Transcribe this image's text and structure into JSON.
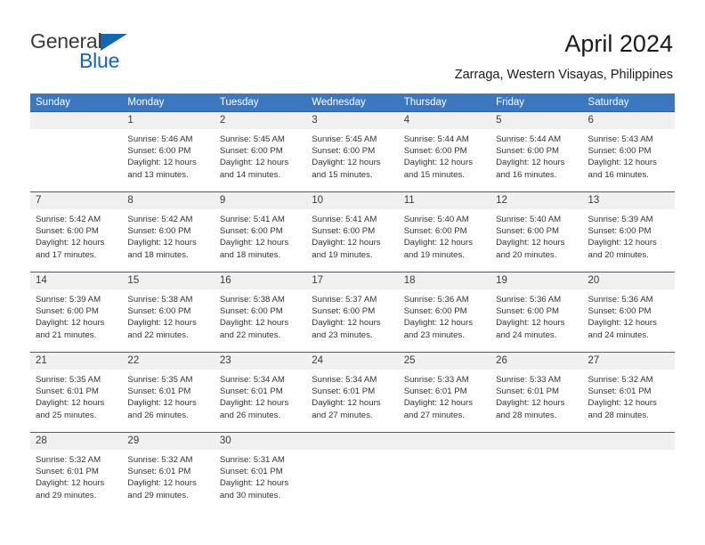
{
  "brand": {
    "name_part1": "General",
    "name_part2": "Blue"
  },
  "header": {
    "title": "April 2024",
    "location": "Zarraga, Western Visayas, Philippines"
  },
  "colors": {
    "header_blue": "#3b78bf",
    "separator_blue": "#2a62a8",
    "day_band_gray": "#f0f0f0",
    "brand_blue": "#1466b3"
  },
  "calendar": {
    "day_headers": [
      "Sunday",
      "Monday",
      "Tuesday",
      "Wednesday",
      "Thursday",
      "Friday",
      "Saturday"
    ],
    "weeks": [
      {
        "days": [
          {
            "num": "",
            "sunrise": "",
            "sunset": "",
            "daylight1": "",
            "daylight2": ""
          },
          {
            "num": "1",
            "sunrise": "Sunrise: 5:46 AM",
            "sunset": "Sunset: 6:00 PM",
            "daylight1": "Daylight: 12 hours",
            "daylight2": "and 13 minutes."
          },
          {
            "num": "2",
            "sunrise": "Sunrise: 5:45 AM",
            "sunset": "Sunset: 6:00 PM",
            "daylight1": "Daylight: 12 hours",
            "daylight2": "and 14 minutes."
          },
          {
            "num": "3",
            "sunrise": "Sunrise: 5:45 AM",
            "sunset": "Sunset: 6:00 PM",
            "daylight1": "Daylight: 12 hours",
            "daylight2": "and 15 minutes."
          },
          {
            "num": "4",
            "sunrise": "Sunrise: 5:44 AM",
            "sunset": "Sunset: 6:00 PM",
            "daylight1": "Daylight: 12 hours",
            "daylight2": "and 15 minutes."
          },
          {
            "num": "5",
            "sunrise": "Sunrise: 5:44 AM",
            "sunset": "Sunset: 6:00 PM",
            "daylight1": "Daylight: 12 hours",
            "daylight2": "and 16 minutes."
          },
          {
            "num": "6",
            "sunrise": "Sunrise: 5:43 AM",
            "sunset": "Sunset: 6:00 PM",
            "daylight1": "Daylight: 12 hours",
            "daylight2": "and 16 minutes."
          }
        ]
      },
      {
        "days": [
          {
            "num": "7",
            "sunrise": "Sunrise: 5:42 AM",
            "sunset": "Sunset: 6:00 PM",
            "daylight1": "Daylight: 12 hours",
            "daylight2": "and 17 minutes."
          },
          {
            "num": "8",
            "sunrise": "Sunrise: 5:42 AM",
            "sunset": "Sunset: 6:00 PM",
            "daylight1": "Daylight: 12 hours",
            "daylight2": "and 18 minutes."
          },
          {
            "num": "9",
            "sunrise": "Sunrise: 5:41 AM",
            "sunset": "Sunset: 6:00 PM",
            "daylight1": "Daylight: 12 hours",
            "daylight2": "and 18 minutes."
          },
          {
            "num": "10",
            "sunrise": "Sunrise: 5:41 AM",
            "sunset": "Sunset: 6:00 PM",
            "daylight1": "Daylight: 12 hours",
            "daylight2": "and 19 minutes."
          },
          {
            "num": "11",
            "sunrise": "Sunrise: 5:40 AM",
            "sunset": "Sunset: 6:00 PM",
            "daylight1": "Daylight: 12 hours",
            "daylight2": "and 19 minutes."
          },
          {
            "num": "12",
            "sunrise": "Sunrise: 5:40 AM",
            "sunset": "Sunset: 6:00 PM",
            "daylight1": "Daylight: 12 hours",
            "daylight2": "and 20 minutes."
          },
          {
            "num": "13",
            "sunrise": "Sunrise: 5:39 AM",
            "sunset": "Sunset: 6:00 PM",
            "daylight1": "Daylight: 12 hours",
            "daylight2": "and 20 minutes."
          }
        ]
      },
      {
        "days": [
          {
            "num": "14",
            "sunrise": "Sunrise: 5:39 AM",
            "sunset": "Sunset: 6:00 PM",
            "daylight1": "Daylight: 12 hours",
            "daylight2": "and 21 minutes."
          },
          {
            "num": "15",
            "sunrise": "Sunrise: 5:38 AM",
            "sunset": "Sunset: 6:00 PM",
            "daylight1": "Daylight: 12 hours",
            "daylight2": "and 22 minutes."
          },
          {
            "num": "16",
            "sunrise": "Sunrise: 5:38 AM",
            "sunset": "Sunset: 6:00 PM",
            "daylight1": "Daylight: 12 hours",
            "daylight2": "and 22 minutes."
          },
          {
            "num": "17",
            "sunrise": "Sunrise: 5:37 AM",
            "sunset": "Sunset: 6:00 PM",
            "daylight1": "Daylight: 12 hours",
            "daylight2": "and 23 minutes."
          },
          {
            "num": "18",
            "sunrise": "Sunrise: 5:36 AM",
            "sunset": "Sunset: 6:00 PM",
            "daylight1": "Daylight: 12 hours",
            "daylight2": "and 23 minutes."
          },
          {
            "num": "19",
            "sunrise": "Sunrise: 5:36 AM",
            "sunset": "Sunset: 6:00 PM",
            "daylight1": "Daylight: 12 hours",
            "daylight2": "and 24 minutes."
          },
          {
            "num": "20",
            "sunrise": "Sunrise: 5:36 AM",
            "sunset": "Sunset: 6:00 PM",
            "daylight1": "Daylight: 12 hours",
            "daylight2": "and 24 minutes."
          }
        ]
      },
      {
        "days": [
          {
            "num": "21",
            "sunrise": "Sunrise: 5:35 AM",
            "sunset": "Sunset: 6:01 PM",
            "daylight1": "Daylight: 12 hours",
            "daylight2": "and 25 minutes."
          },
          {
            "num": "22",
            "sunrise": "Sunrise: 5:35 AM",
            "sunset": "Sunset: 6:01 PM",
            "daylight1": "Daylight: 12 hours",
            "daylight2": "and 26 minutes."
          },
          {
            "num": "23",
            "sunrise": "Sunrise: 5:34 AM",
            "sunset": "Sunset: 6:01 PM",
            "daylight1": "Daylight: 12 hours",
            "daylight2": "and 26 minutes."
          },
          {
            "num": "24",
            "sunrise": "Sunrise: 5:34 AM",
            "sunset": "Sunset: 6:01 PM",
            "daylight1": "Daylight: 12 hours",
            "daylight2": "and 27 minutes."
          },
          {
            "num": "25",
            "sunrise": "Sunrise: 5:33 AM",
            "sunset": "Sunset: 6:01 PM",
            "daylight1": "Daylight: 12 hours",
            "daylight2": "and 27 minutes."
          },
          {
            "num": "26",
            "sunrise": "Sunrise: 5:33 AM",
            "sunset": "Sunset: 6:01 PM",
            "daylight1": "Daylight: 12 hours",
            "daylight2": "and 28 minutes."
          },
          {
            "num": "27",
            "sunrise": "Sunrise: 5:32 AM",
            "sunset": "Sunset: 6:01 PM",
            "daylight1": "Daylight: 12 hours",
            "daylight2": "and 28 minutes."
          }
        ]
      },
      {
        "days": [
          {
            "num": "28",
            "sunrise": "Sunrise: 5:32 AM",
            "sunset": "Sunset: 6:01 PM",
            "daylight1": "Daylight: 12 hours",
            "daylight2": "and 29 minutes."
          },
          {
            "num": "29",
            "sunrise": "Sunrise: 5:32 AM",
            "sunset": "Sunset: 6:01 PM",
            "daylight1": "Daylight: 12 hours",
            "daylight2": "and 29 minutes."
          },
          {
            "num": "30",
            "sunrise": "Sunrise: 5:31 AM",
            "sunset": "Sunset: 6:01 PM",
            "daylight1": "Daylight: 12 hours",
            "daylight2": "and 30 minutes."
          },
          {
            "num": "",
            "sunrise": "",
            "sunset": "",
            "daylight1": "",
            "daylight2": ""
          },
          {
            "num": "",
            "sunrise": "",
            "sunset": "",
            "daylight1": "",
            "daylight2": ""
          },
          {
            "num": "",
            "sunrise": "",
            "sunset": "",
            "daylight1": "",
            "daylight2": ""
          },
          {
            "num": "",
            "sunrise": "",
            "sunset": "",
            "daylight1": "",
            "daylight2": ""
          }
        ]
      }
    ]
  }
}
